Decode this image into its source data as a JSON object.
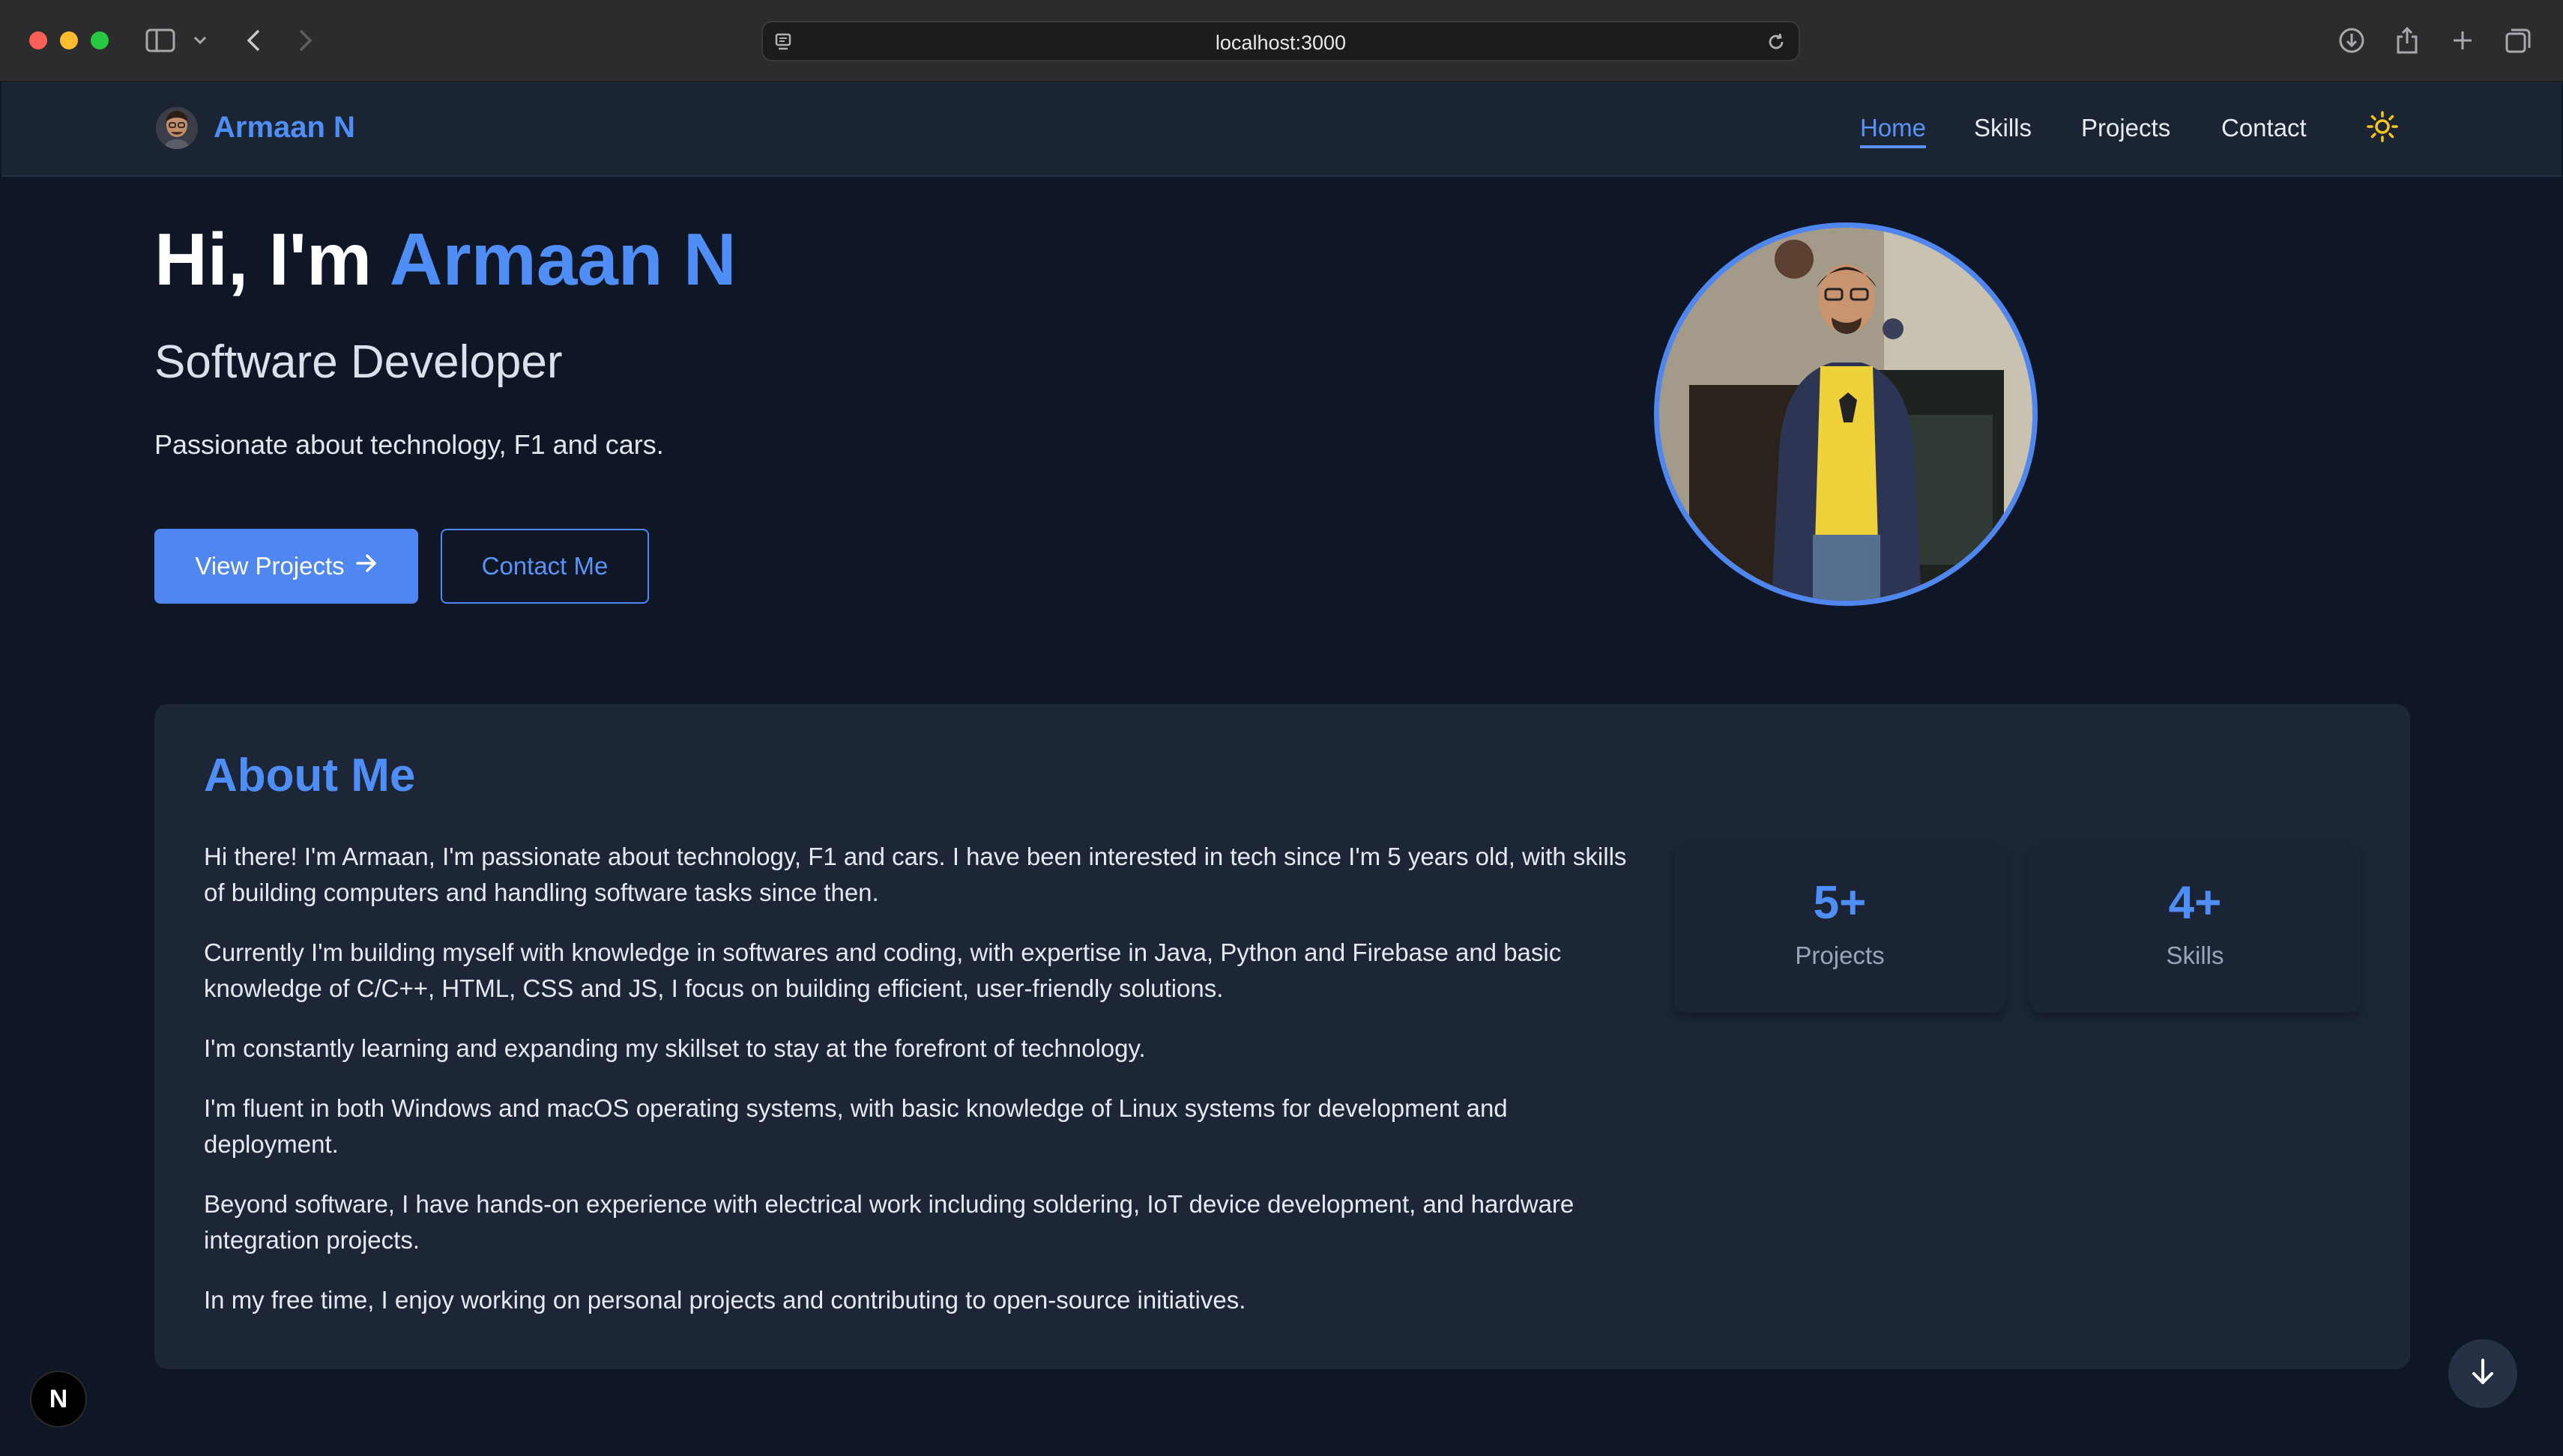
{
  "browser": {
    "url": "localhost:3000"
  },
  "nav": {
    "brand": "Armaan N",
    "links": [
      "Home",
      "Skills",
      "Projects",
      "Contact"
    ],
    "active": "Home",
    "theme_icon": "sun-icon"
  },
  "hero": {
    "greeting": "Hi, I'm ",
    "name": "Armaan N",
    "role": "Software Developer",
    "tagline": "Passionate about technology, F1 and cars.",
    "primary_button": "View Projects",
    "secondary_button": "Contact Me"
  },
  "about": {
    "title": "About Me",
    "paragraphs": [
      "Hi there! I'm Armaan, I'm passionate about technology, F1 and cars. I have been interested in tech since I'm 5 years old, with skills of building computers and handling software tasks since then.",
      "Currently I'm building myself with knowledge in softwares and coding, with expertise in Java, Python and Firebase and basic knowledge of C/C++, HTML, CSS and JS, I focus on building efficient, user-friendly solutions.",
      "I'm constantly learning and expanding my skillset to stay at the forefront of technology.",
      "I'm fluent in both Windows and macOS operating systems, with basic knowledge of Linux systems for development and deployment.",
      "Beyond software, I have hands-on experience with electrical work including soldering, IoT device development, and hardware integration projects.",
      "In my free time, I enjoy working on personal projects and contributing to open-source initiatives."
    ],
    "stats": [
      {
        "value": "5+",
        "label": "Projects"
      },
      {
        "value": "4+",
        "label": "Skills"
      }
    ]
  },
  "dev_badge": "N",
  "colors": {
    "accent": "#4f8ef7",
    "background": "#0f1626",
    "card": "#1d2637"
  }
}
